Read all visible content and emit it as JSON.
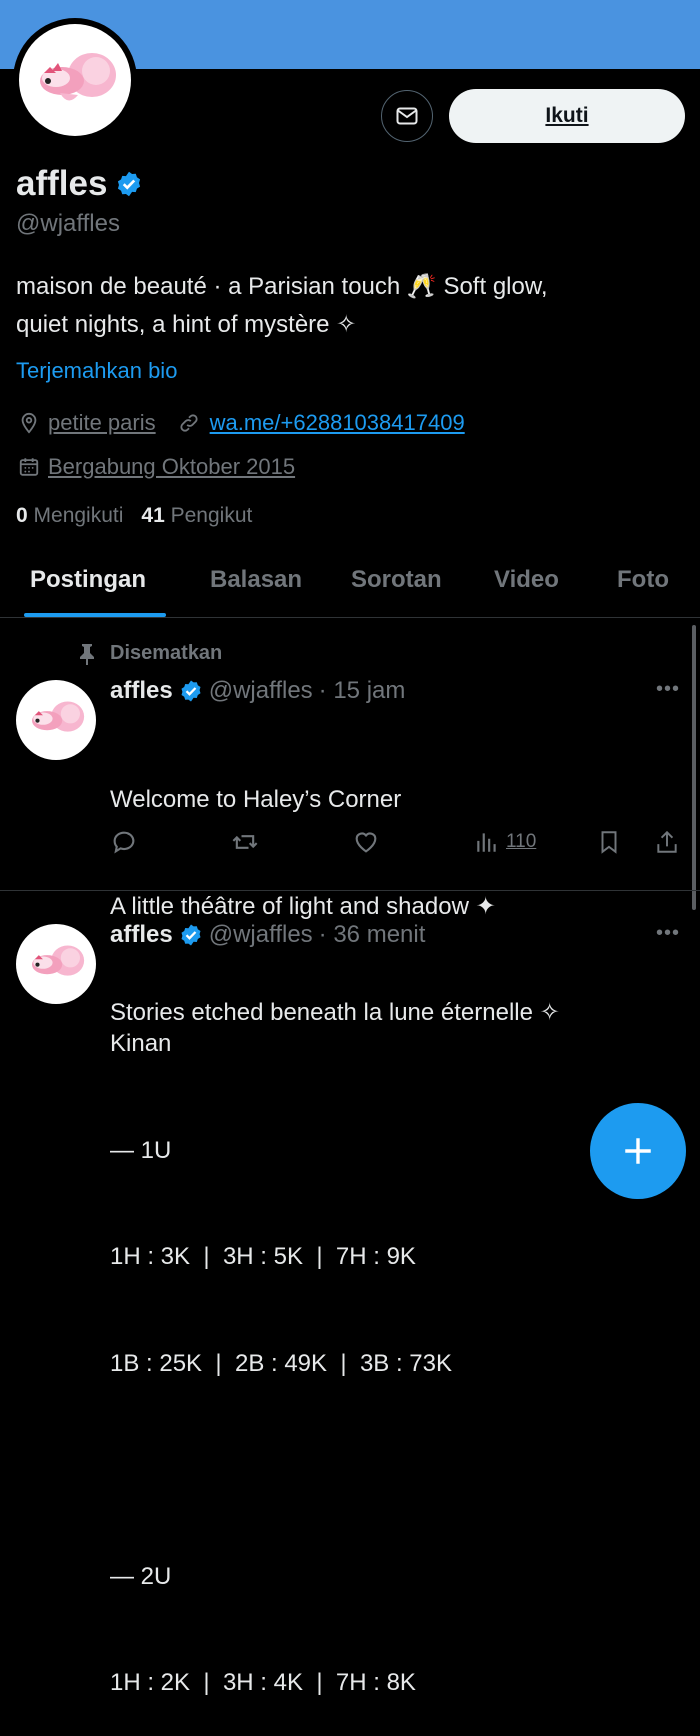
{
  "profile": {
    "display_name": "affles",
    "handle": "@wjaffles",
    "bio_line1": "maison de beauté · a Parisian touch 🥂 Soft glow,",
    "bio_line2": "quiet nights, a hint of mystère ✧",
    "translate_bio": "Terjemahkan bio",
    "location": "petite paris",
    "website": "wa.me/+62881038417409",
    "joined": "Bergabung Oktober 2015",
    "following_count": "0",
    "following_label": "Mengikuti",
    "followers_count": "41",
    "followers_label": "Pengikut",
    "follow_button": "Ikuti",
    "verified": true
  },
  "tabs": [
    {
      "label": "Postingan",
      "active": true
    },
    {
      "label": "Balasan",
      "active": false
    },
    {
      "label": "Sorotan",
      "active": false
    },
    {
      "label": "Video",
      "active": false
    },
    {
      "label": "Foto",
      "active": false
    }
  ],
  "posts": [
    {
      "pinned_label": "Disematkan",
      "name": "affles",
      "handle": "@wjaffles",
      "time": "· 15 jam",
      "lines": [
        "Welcome to Haley’s Corner",
        "A little théâtre of light and shadow ✦",
        "Stories etched beneath la lune éternelle ✧"
      ],
      "views": "110"
    },
    {
      "name": "affles",
      "handle": "@wjaffles",
      "time": "· 36 menit",
      "lines": [
        "Kinan",
        "— 1U",
        "1H : 3K  |  3H : 5K  |  7H : 9K",
        "1B : 25K  |  2B : 49K  |  3B : 73K",
        "",
        "— 2U",
        "1H : 2K  |  3H : 4K  |  7H : 8K"
      ]
    }
  ],
  "colors": {
    "accent": "#1d9bf0",
    "banner": "#4a93e0",
    "background": "#000000",
    "muted": "#71767b"
  },
  "icons": [
    "mail-icon",
    "verified-badge-icon",
    "location-icon",
    "link-icon",
    "calendar-icon",
    "pin-icon",
    "reply-icon",
    "repost-icon",
    "like-icon",
    "views-icon",
    "bookmark-icon",
    "share-icon",
    "more-icon",
    "plus-icon"
  ]
}
